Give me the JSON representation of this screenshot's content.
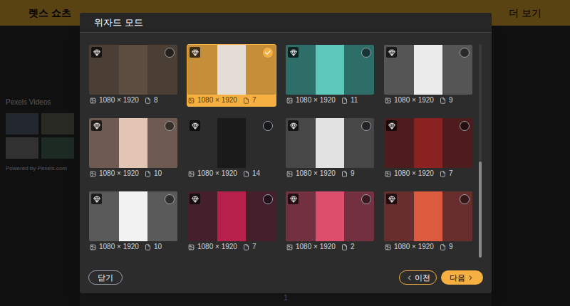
{
  "app": {
    "title": "렛스 쇼츠",
    "menu": [
      "더 보기"
    ],
    "page": "1",
    "source": "Pexels Videos",
    "credit": "Powered by Pexels.com"
  },
  "dialog": {
    "title": "위자드 모드",
    "templates": [
      {
        "size": "1080 × 1920",
        "pages": "8",
        "selected": false,
        "premium": true,
        "color": "#4a3e35",
        "center": "#5c4d40"
      },
      {
        "size": "1080 × 1920",
        "pages": "7",
        "selected": true,
        "premium": true,
        "color": "#c58f3a",
        "center": "#e4ddd6"
      },
      {
        "size": "1080 × 1920",
        "pages": "11",
        "selected": false,
        "premium": true,
        "color": "#2e6e69",
        "center": "#5ec8bd"
      },
      {
        "size": "1080 × 1920",
        "pages": "9",
        "selected": false,
        "premium": true,
        "color": "#555555",
        "center": "#ececec"
      },
      {
        "size": "1080 × 1920",
        "pages": "10",
        "selected": false,
        "premium": true,
        "color": "#6e5a50",
        "center": "#e3c5b4"
      },
      {
        "size": "1080 × 1920",
        "pages": "14",
        "selected": false,
        "premium": true,
        "color": "#2c2c2c",
        "center": "#1a1a1a"
      },
      {
        "size": "1080 × 1920",
        "pages": "9",
        "selected": false,
        "premium": true,
        "color": "#474747",
        "center": "#e2e2e2"
      },
      {
        "size": "1080 × 1920",
        "pages": "7",
        "selected": false,
        "premium": true,
        "color": "#4e1c1c",
        "center": "#8a2222"
      },
      {
        "size": "1080 × 1920",
        "pages": "10",
        "selected": false,
        "premium": true,
        "color": "#5a5a5a",
        "center": "#f2f2f2"
      },
      {
        "size": "1080 × 1920",
        "pages": "7",
        "selected": false,
        "premium": true,
        "color": "#45202c",
        "center": "#b8204c"
      },
      {
        "size": "1080 × 1920",
        "pages": "2",
        "selected": false,
        "premium": true,
        "color": "#733040",
        "center": "#dc4e6c"
      },
      {
        "size": "1080 × 1920",
        "pages": "9",
        "selected": false,
        "premium": true,
        "color": "#682e2e",
        "center": "#dc5a3e"
      }
    ],
    "scroll": {
      "level": 0.45
    },
    "buttons": {
      "close": "닫기",
      "prev": "이전",
      "next": "다음"
    }
  }
}
